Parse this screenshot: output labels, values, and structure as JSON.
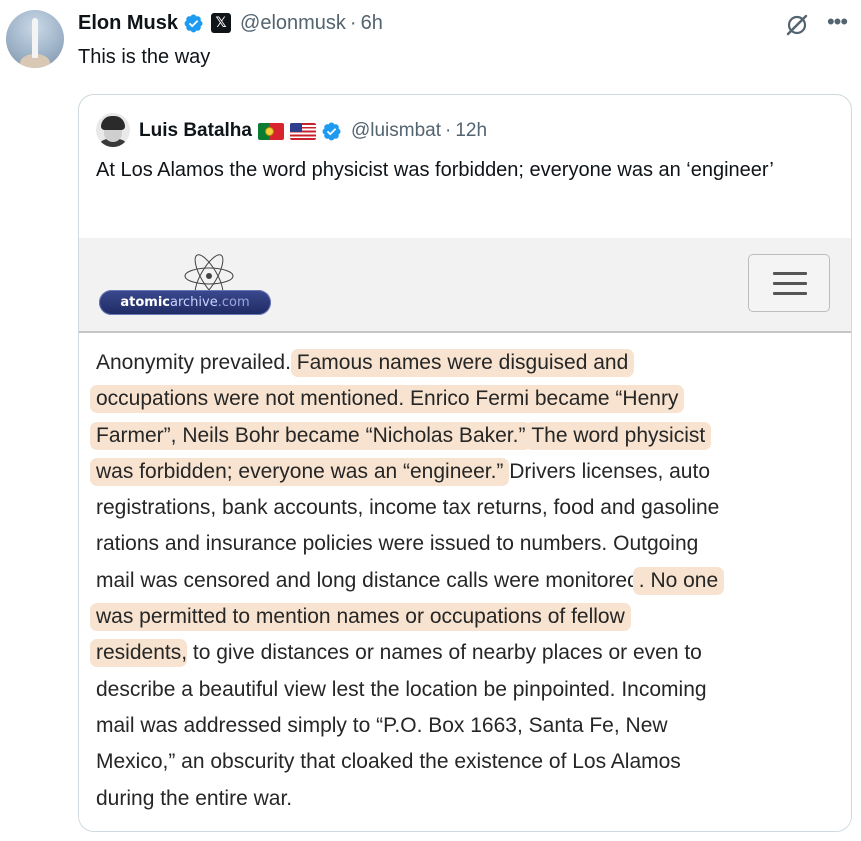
{
  "tweet": {
    "author_name": "Elon Musk",
    "author_handle": "@elonmusk",
    "separator": "·",
    "time": "6h",
    "text": "This is the way",
    "badge_icon": "verified-icon",
    "affiliation_icon": "x-logo-icon"
  },
  "quoted_tweet": {
    "author_name": "Luis Batalha",
    "author_handle": "@luismbat",
    "separator": "·",
    "time": "12h",
    "text": "At Los Alamos the word physicist was forbidden; everyone was an ‘engineer’",
    "flags": [
      "portugal-flag-icon",
      "usa-flag-icon"
    ]
  },
  "article": {
    "site_logo": "atomicarchive.com",
    "logo_parts": [
      "atomic",
      "archive",
      ".com"
    ],
    "menu_icon": "hamburger-menu-icon",
    "lines": [
      [
        {
          "t": "Anonymity prevailed. ",
          "h": false
        },
        {
          "t": "Famous names were disguised and",
          "h": true
        }
      ],
      [
        {
          "t": "occupations were not mentioned. Enrico Fermi became “Henry",
          "h": true
        }
      ],
      [
        {
          "t": "Farmer”, Neils Bohr became “Nicholas Baker.”",
          "h": true
        },
        {
          "t": " ",
          "h": false
        },
        {
          "t": "The word physicist",
          "h": true
        }
      ],
      [
        {
          "t": "was forbidden; everyone was an “engineer.”",
          "h": true
        },
        {
          "t": " Drivers licenses, auto",
          "h": false
        }
      ],
      [
        {
          "t": "registrations, bank accounts, income tax returns, food and gasoline",
          "h": false
        }
      ],
      [
        {
          "t": "rations and insurance policies were issued to numbers. Outgoing",
          "h": false
        }
      ],
      [
        {
          "t": "mail was censored and long distance calls were monitored",
          "h": false
        },
        {
          "t": ". No one",
          "h": true
        }
      ],
      [
        {
          "t": "was permitted to mention names or occupations of fellow",
          "h": true
        }
      ],
      [
        {
          "t": "residents",
          "h": true
        },
        {
          "t": ", to give distances or names of nearby places or even to",
          "h": false
        }
      ],
      [
        {
          "t": "describe a beautiful view lest the location be pinpointed. Incoming",
          "h": false
        }
      ],
      [
        {
          "t": "mail was addressed simply to “P.O. Box 1663, Santa Fe, New",
          "h": false
        }
      ],
      [
        {
          "t": "Mexico,” an obscurity that cloaked the existence of Los Alamos",
          "h": false
        }
      ],
      [
        {
          "t": "during the entire war.",
          "h": false
        }
      ]
    ]
  },
  "colors": {
    "highlight": "#f7e3cf",
    "verified": "#1d9bf0",
    "secondary_text": "#536471",
    "border": "#cfd9de"
  },
  "icons": {
    "grok": "grok-icon",
    "more": "more-options-icon"
  }
}
